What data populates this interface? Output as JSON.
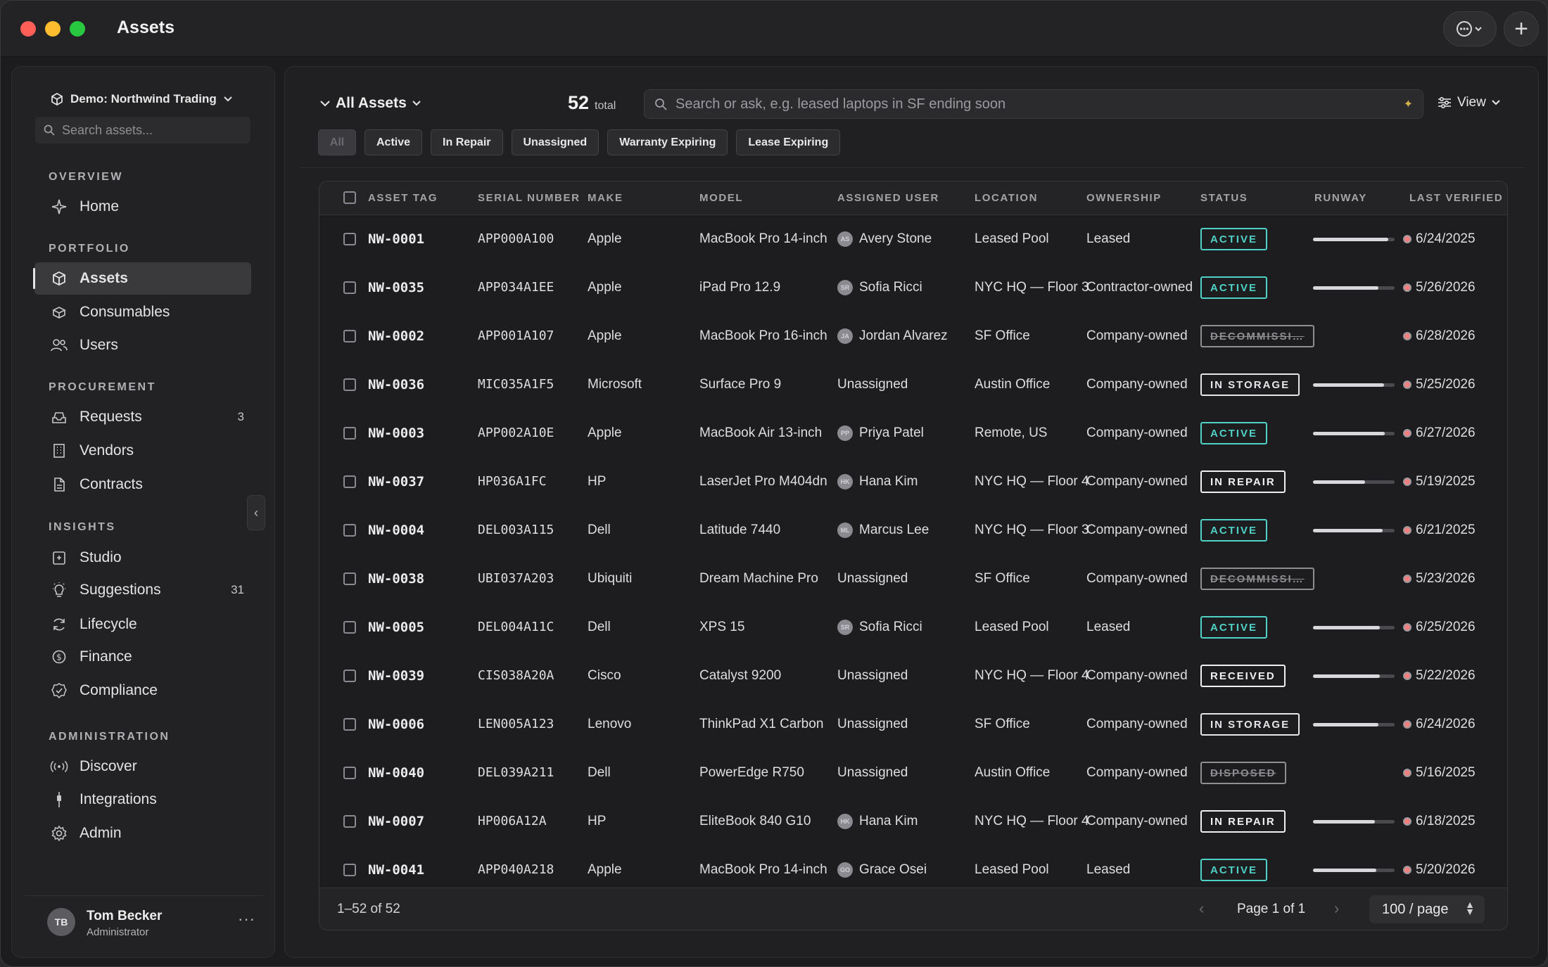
{
  "window": {
    "title": "Assets"
  },
  "sidebar": {
    "workspace": "Demo: Northwind Trading",
    "search_placeholder": "Search assets...",
    "sections": {
      "overview": "OVERVIEW",
      "portfolio": "PORTFOLIO",
      "procurement": "PROCUREMENT",
      "insights": "INSIGHTS",
      "administration": "ADMINISTRATION"
    },
    "items": {
      "home": "Home",
      "assets": "Assets",
      "consumables": "Consumables",
      "users": "Users",
      "requests": "Requests",
      "requests_badge": "3",
      "vendors": "Vendors",
      "contracts": "Contracts",
      "studio": "Studio",
      "suggestions": "Suggestions",
      "suggestions_badge": "31",
      "lifecycle": "Lifecycle",
      "finance": "Finance",
      "compliance": "Compliance",
      "discover": "Discover",
      "integrations": "Integrations",
      "admin": "Admin"
    },
    "user": {
      "initials": "TB",
      "name": "Tom Becker",
      "role": "Administrator"
    }
  },
  "toolbar": {
    "view_name": "All Assets",
    "total_count": "52",
    "total_label": "total",
    "search_placeholder": "Search or ask, e.g. leased laptops in SF ending soon",
    "view_label": "View"
  },
  "filters": [
    "All",
    "Active",
    "In Repair",
    "Unassigned",
    "Warranty Expiring",
    "Lease Expiring"
  ],
  "table": {
    "columns": [
      "ASSET TAG",
      "SERIAL NUMBER",
      "MAKE",
      "MODEL",
      "ASSIGNED USER",
      "LOCATION",
      "OWNERSHIP",
      "STATUS",
      "RUNWAY",
      "LAST VERIFIED"
    ],
    "rows": [
      {
        "tag": "NW-0001",
        "serial": "APP000A100",
        "make": "Apple",
        "model": "MacBook Pro 14-inch",
        "user": "Avery Stone",
        "initials": "AS",
        "location": "Leased Pool",
        "ownership": "Leased",
        "status": "ACTIVE",
        "status_color": "#4fd1c5",
        "runway": 0.92,
        "verified": "6/24/2025"
      },
      {
        "tag": "NW-0035",
        "serial": "APP034A1EE",
        "make": "Apple",
        "model": "iPad Pro 12.9",
        "user": "Sofia Ricci",
        "initials": "SR",
        "location": "NYC HQ — Floor 3",
        "ownership": "Contractor-owned",
        "status": "ACTIVE",
        "status_color": "#4fd1c5",
        "runway": 0.8,
        "verified": "5/26/2026"
      },
      {
        "tag": "NW-0002",
        "serial": "APP001A107",
        "make": "Apple",
        "model": "MacBook Pro 16-inch",
        "user": "Jordan Alvarez",
        "initials": "JA",
        "location": "SF Office",
        "ownership": "Company-owned",
        "status": "DECOMMISSI…",
        "status_color": "#8e8e93",
        "runway": null,
        "verified": "6/28/2026"
      },
      {
        "tag": "NW-0036",
        "serial": "MIC035A1F5",
        "make": "Microsoft",
        "model": "Surface Pro 9",
        "user": "Unassigned",
        "initials": "",
        "location": "Austin Office",
        "ownership": "Company-owned",
        "status": "IN STORAGE",
        "status_color": "#e5e5ea",
        "runway": 0.87,
        "verified": "5/25/2026"
      },
      {
        "tag": "NW-0003",
        "serial": "APP002A10E",
        "make": "Apple",
        "model": "MacBook Air 13-inch",
        "user": "Priya Patel",
        "initials": "PP",
        "location": "Remote, US",
        "ownership": "Company-owned",
        "status": "ACTIVE",
        "status_color": "#4fd1c5",
        "runway": 0.88,
        "verified": "6/27/2026"
      },
      {
        "tag": "NW-0037",
        "serial": "HP036A1FC",
        "make": "HP",
        "model": "LaserJet Pro M404dn",
        "user": "Hana Kim",
        "initials": "HK",
        "location": "NYC HQ — Floor 4",
        "ownership": "Company-owned",
        "status": "IN REPAIR",
        "status_color": "#f0f0f2",
        "runway": 0.64,
        "verified": "5/19/2025"
      },
      {
        "tag": "NW-0004",
        "serial": "DEL003A115",
        "make": "Dell",
        "model": "Latitude 7440",
        "user": "Marcus Lee",
        "initials": "ML",
        "location": "NYC HQ — Floor 3",
        "ownership": "Company-owned",
        "status": "ACTIVE",
        "status_color": "#4fd1c5",
        "runway": 0.85,
        "verified": "6/21/2025"
      },
      {
        "tag": "NW-0038",
        "serial": "UBI037A203",
        "make": "Ubiquiti",
        "model": "Dream Machine Pro",
        "user": "Unassigned",
        "initials": "",
        "location": "SF Office",
        "ownership": "Company-owned",
        "status": "DECOMMISSI…",
        "status_color": "#8e8e93",
        "runway": null,
        "verified": "5/23/2026"
      },
      {
        "tag": "NW-0005",
        "serial": "DEL004A11C",
        "make": "Dell",
        "model": "XPS 15",
        "user": "Sofia Ricci",
        "initials": "SR",
        "location": "Leased Pool",
        "ownership": "Leased",
        "status": "ACTIVE",
        "status_color": "#4fd1c5",
        "runway": 0.82,
        "verified": "6/25/2026"
      },
      {
        "tag": "NW-0039",
        "serial": "CIS038A20A",
        "make": "Cisco",
        "model": "Catalyst 9200",
        "user": "Unassigned",
        "initials": "",
        "location": "NYC HQ — Floor 4",
        "ownership": "Company-owned",
        "status": "RECEIVED",
        "status_color": "#f0f0f2",
        "runway": 0.82,
        "verified": "5/22/2026"
      },
      {
        "tag": "NW-0006",
        "serial": "LEN005A123",
        "make": "Lenovo",
        "model": "ThinkPad X1 Carbon",
        "user": "Unassigned",
        "initials": "",
        "location": "SF Office",
        "ownership": "Company-owned",
        "status": "IN STORAGE",
        "status_color": "#e5e5ea",
        "runway": 0.8,
        "verified": "6/24/2026"
      },
      {
        "tag": "NW-0040",
        "serial": "DEL039A211",
        "make": "Dell",
        "model": "PowerEdge R750",
        "user": "Unassigned",
        "initials": "",
        "location": "Austin Office",
        "ownership": "Company-owned",
        "status": "DISPOSED",
        "status_color": "#8e8e93",
        "runway": null,
        "verified": "5/16/2025"
      },
      {
        "tag": "NW-0007",
        "serial": "HP006A12A",
        "make": "HP",
        "model": "EliteBook 840 G10",
        "user": "Hana Kim",
        "initials": "HK",
        "location": "NYC HQ — Floor 4",
        "ownership": "Company-owned",
        "status": "IN REPAIR",
        "status_color": "#f0f0f2",
        "runway": 0.76,
        "verified": "6/18/2025"
      },
      {
        "tag": "NW-0041",
        "serial": "APP040A218",
        "make": "Apple",
        "model": "MacBook Pro 14-inch",
        "user": "Grace Osei",
        "initials": "GO",
        "location": "Leased Pool",
        "ownership": "Leased",
        "status": "ACTIVE",
        "status_color": "#4fd1c5",
        "runway": 0.78,
        "verified": "5/20/2026"
      }
    ],
    "footer": {
      "range": "1–52 of 52",
      "page": "Page 1 of 1",
      "per_page": "100 / page"
    }
  }
}
